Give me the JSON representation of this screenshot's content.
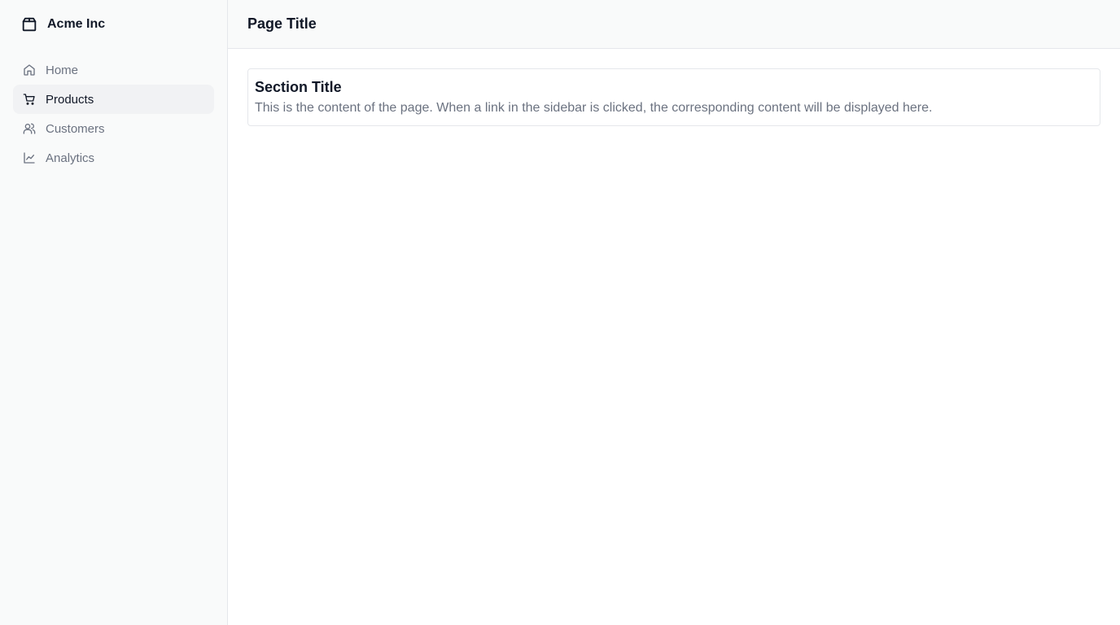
{
  "brand": {
    "name": "Acme Inc",
    "icon": "package-icon"
  },
  "sidebar": {
    "items": [
      {
        "label": "Home",
        "icon": "home-icon",
        "active": false
      },
      {
        "label": "Products",
        "icon": "cart-icon",
        "active": true
      },
      {
        "label": "Customers",
        "icon": "users-icon",
        "active": false
      },
      {
        "label": "Analytics",
        "icon": "line-chart-icon",
        "active": false
      }
    ]
  },
  "header": {
    "title": "Page Title"
  },
  "main": {
    "section_title": "Section Title",
    "section_body": "This is the content of the page. When a link in the sidebar is clicked, the corresponding content will be displayed here."
  },
  "colors": {
    "sidebar_bg": "#f9fafa",
    "active_item_bg": "#f1f2f4",
    "border": "#e5e7eb",
    "muted_text": "#6b7280",
    "primary_text": "#111827"
  }
}
